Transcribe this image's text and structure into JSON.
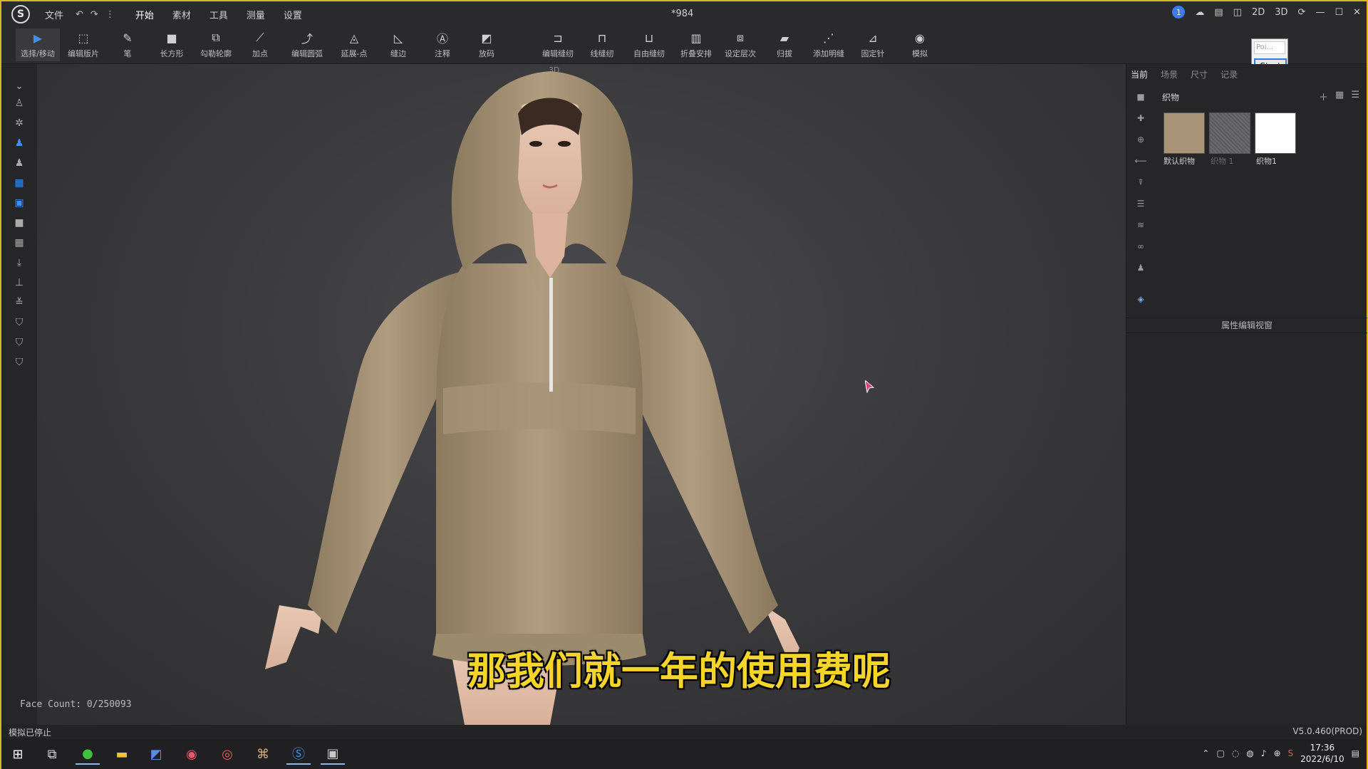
{
  "window": {
    "logo": "S",
    "file_menu": "文件",
    "title": "*984",
    "menus": [
      "开始",
      "素材",
      "工具",
      "测量",
      "设置"
    ],
    "right_controls": {
      "notifications": "1",
      "view_2d": "2D",
      "view_3d": "3D"
    }
  },
  "toolbar": {
    "tools": [
      {
        "label": "选择/移动",
        "icon": "cursor-icon"
      },
      {
        "label": "编辑版片",
        "icon": "edit-pattern-icon"
      },
      {
        "label": "笔",
        "icon": "pen-icon"
      },
      {
        "label": "长方形",
        "icon": "rectangle-icon"
      },
      {
        "label": "勾勒轮廓",
        "icon": "trace-icon"
      },
      {
        "label": "加点",
        "icon": "add-point-icon"
      },
      {
        "label": "编辑圆弧",
        "icon": "curve-icon"
      },
      {
        "label": "延展-点",
        "icon": "extend-point-icon"
      },
      {
        "label": "缝边",
        "icon": "seam-allowance-icon"
      },
      {
        "label": "注释",
        "icon": "annotation-icon"
      },
      {
        "label": "放码",
        "icon": "grading-icon"
      },
      {
        "label": "编辑缝纫",
        "icon": "edit-sewing-icon"
      },
      {
        "label": "线缝纫",
        "icon": "segment-sewing-icon"
      },
      {
        "label": "自由缝纫",
        "icon": "free-sewing-icon"
      },
      {
        "label": "折叠安排",
        "icon": "fold-arrange-icon"
      },
      {
        "label": "设定层次",
        "icon": "layer-icon"
      },
      {
        "label": "归拔",
        "icon": "shrink-icon"
      },
      {
        "label": "添加明缝",
        "icon": "topstitch-icon"
      },
      {
        "label": "固定针",
        "icon": "pin-icon"
      },
      {
        "label": "模拟",
        "icon": "simulate-icon"
      }
    ]
  },
  "viewport": {
    "label": "3D",
    "face_count": "Face Count: 0/250093",
    "subtitle": "那我们就一年的使用费呢"
  },
  "popup": {
    "input_placeholder": "Poi...",
    "start_button": "Start"
  },
  "right_panel": {
    "tabs": [
      "当前",
      "场景",
      "尺寸",
      "记录"
    ],
    "library_title": "织物",
    "fabrics": [
      {
        "label": "默认织物",
        "color": "#a89376"
      },
      {
        "label": "织物 1",
        "color": "#5b5b5e"
      },
      {
        "label": "织物1",
        "color": "#ffffff"
      }
    ],
    "property_title": "属性编辑视窗"
  },
  "status": {
    "left": "模拟已停止",
    "right": "V5.0.460(PROD)"
  },
  "taskbar": {
    "time": "17:36",
    "date": "2022/6/10"
  },
  "colors": {
    "accent": "#3f8ef0",
    "subtitle": "#f5d52a",
    "frame": "#e0b51a",
    "hoodie": "#a89376"
  }
}
